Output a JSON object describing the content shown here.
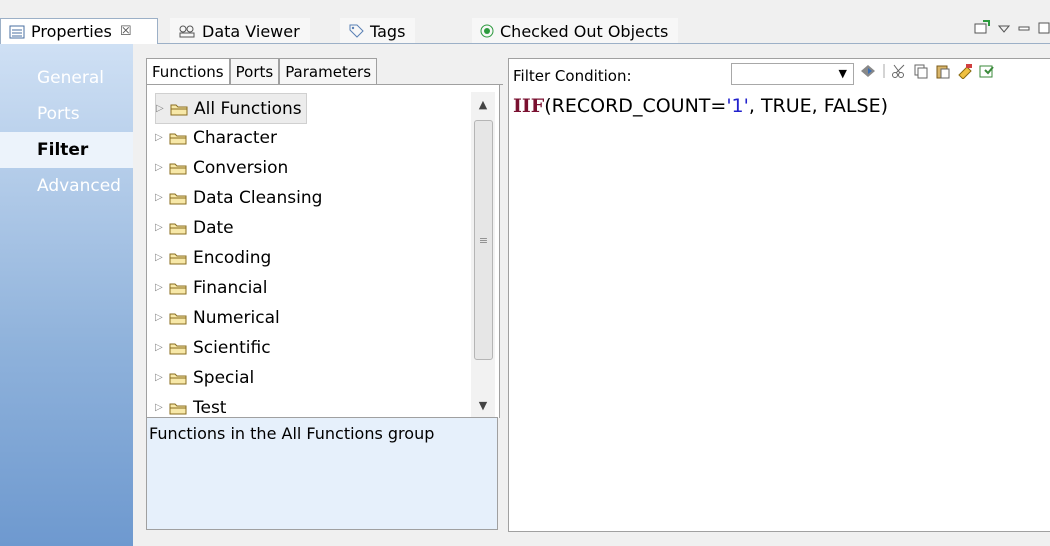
{
  "tabs": [
    {
      "label": "Properties",
      "icon": "properties-view-icon",
      "active": true,
      "close": "☒"
    },
    {
      "label": "Data Viewer",
      "icon": "data-viewer-icon"
    },
    {
      "label": "Tags",
      "icon": "tag-icon"
    },
    {
      "label": "Checked Out Objects",
      "icon": "checked-out-icon"
    }
  ],
  "sidebar": {
    "items": [
      {
        "label": "General"
      },
      {
        "label": "Ports"
      },
      {
        "label": "Filter",
        "selected": true
      },
      {
        "label": "Advanced"
      }
    ]
  },
  "functions_panel": {
    "tabs": [
      {
        "label": "Functions"
      },
      {
        "label": "Ports"
      },
      {
        "label": "Parameters"
      }
    ],
    "tree": [
      {
        "label": "All Functions"
      },
      {
        "label": "Character"
      },
      {
        "label": "Conversion"
      },
      {
        "label": "Data Cleansing"
      },
      {
        "label": "Date"
      },
      {
        "label": "Encoding"
      },
      {
        "label": "Financial"
      },
      {
        "label": "Numerical"
      },
      {
        "label": "Scientific"
      },
      {
        "label": "Special"
      },
      {
        "label": "Test"
      }
    ],
    "description": "Functions in the All Functions group"
  },
  "editor": {
    "label": "Filter Condition:",
    "combo_value": "",
    "expression": {
      "keyword": "IIF",
      "open": "(RECORD_COUNT=",
      "string": "'1'",
      "rest": ", TRUE, FALSE)"
    }
  },
  "colors": {
    "sidebar_gradient_top": "#cfe0f4",
    "sidebar_gradient_bottom": "#6e99cf",
    "keyword": "#7a1030",
    "string_literal": "#2222cc",
    "description_bg": "#e6f0fb"
  }
}
